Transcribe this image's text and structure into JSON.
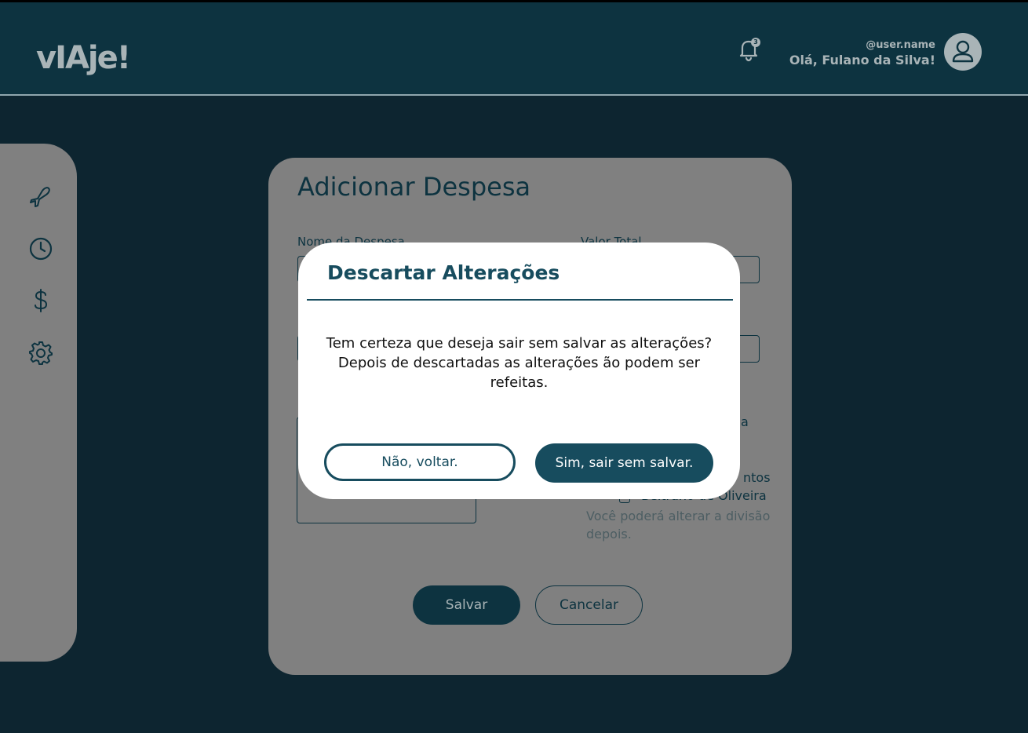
{
  "header": {
    "logo": "vIAje!",
    "notification_count": "3",
    "user_handle": "@user.name",
    "greeting": "Olá, Fulano da Silva!"
  },
  "sidebar": {
    "items": [
      {
        "icon": "plane-icon"
      },
      {
        "icon": "clock-icon"
      },
      {
        "icon": "dollar-icon"
      },
      {
        "icon": "gear-icon"
      }
    ]
  },
  "form": {
    "title": "Adicionar Despesa",
    "name_label": "Nome da Despesa",
    "total_label": "Valor Total",
    "participant_partial_1": "ntos",
    "participant_3": "Beltrano de Oliveira",
    "hint": "Você poderá alterar a divisão depois.",
    "save_label": "Salvar",
    "cancel_label": "Cancelar"
  },
  "modal": {
    "title": "Descartar Alterações",
    "message": "Tem certeza que deseja sair sem salvar as alterações? Depois de descartadas as alterações ão podem ser refeitas.",
    "no_label": "Não, voltar.",
    "yes_label": "Sim, sair sem salvar."
  },
  "colors": {
    "header_bg": "#0d3340",
    "page_bg": "#0d2530",
    "overlay_gray": "#808080",
    "accent": "#174c5e",
    "muted_text": "#a9b4b7"
  }
}
